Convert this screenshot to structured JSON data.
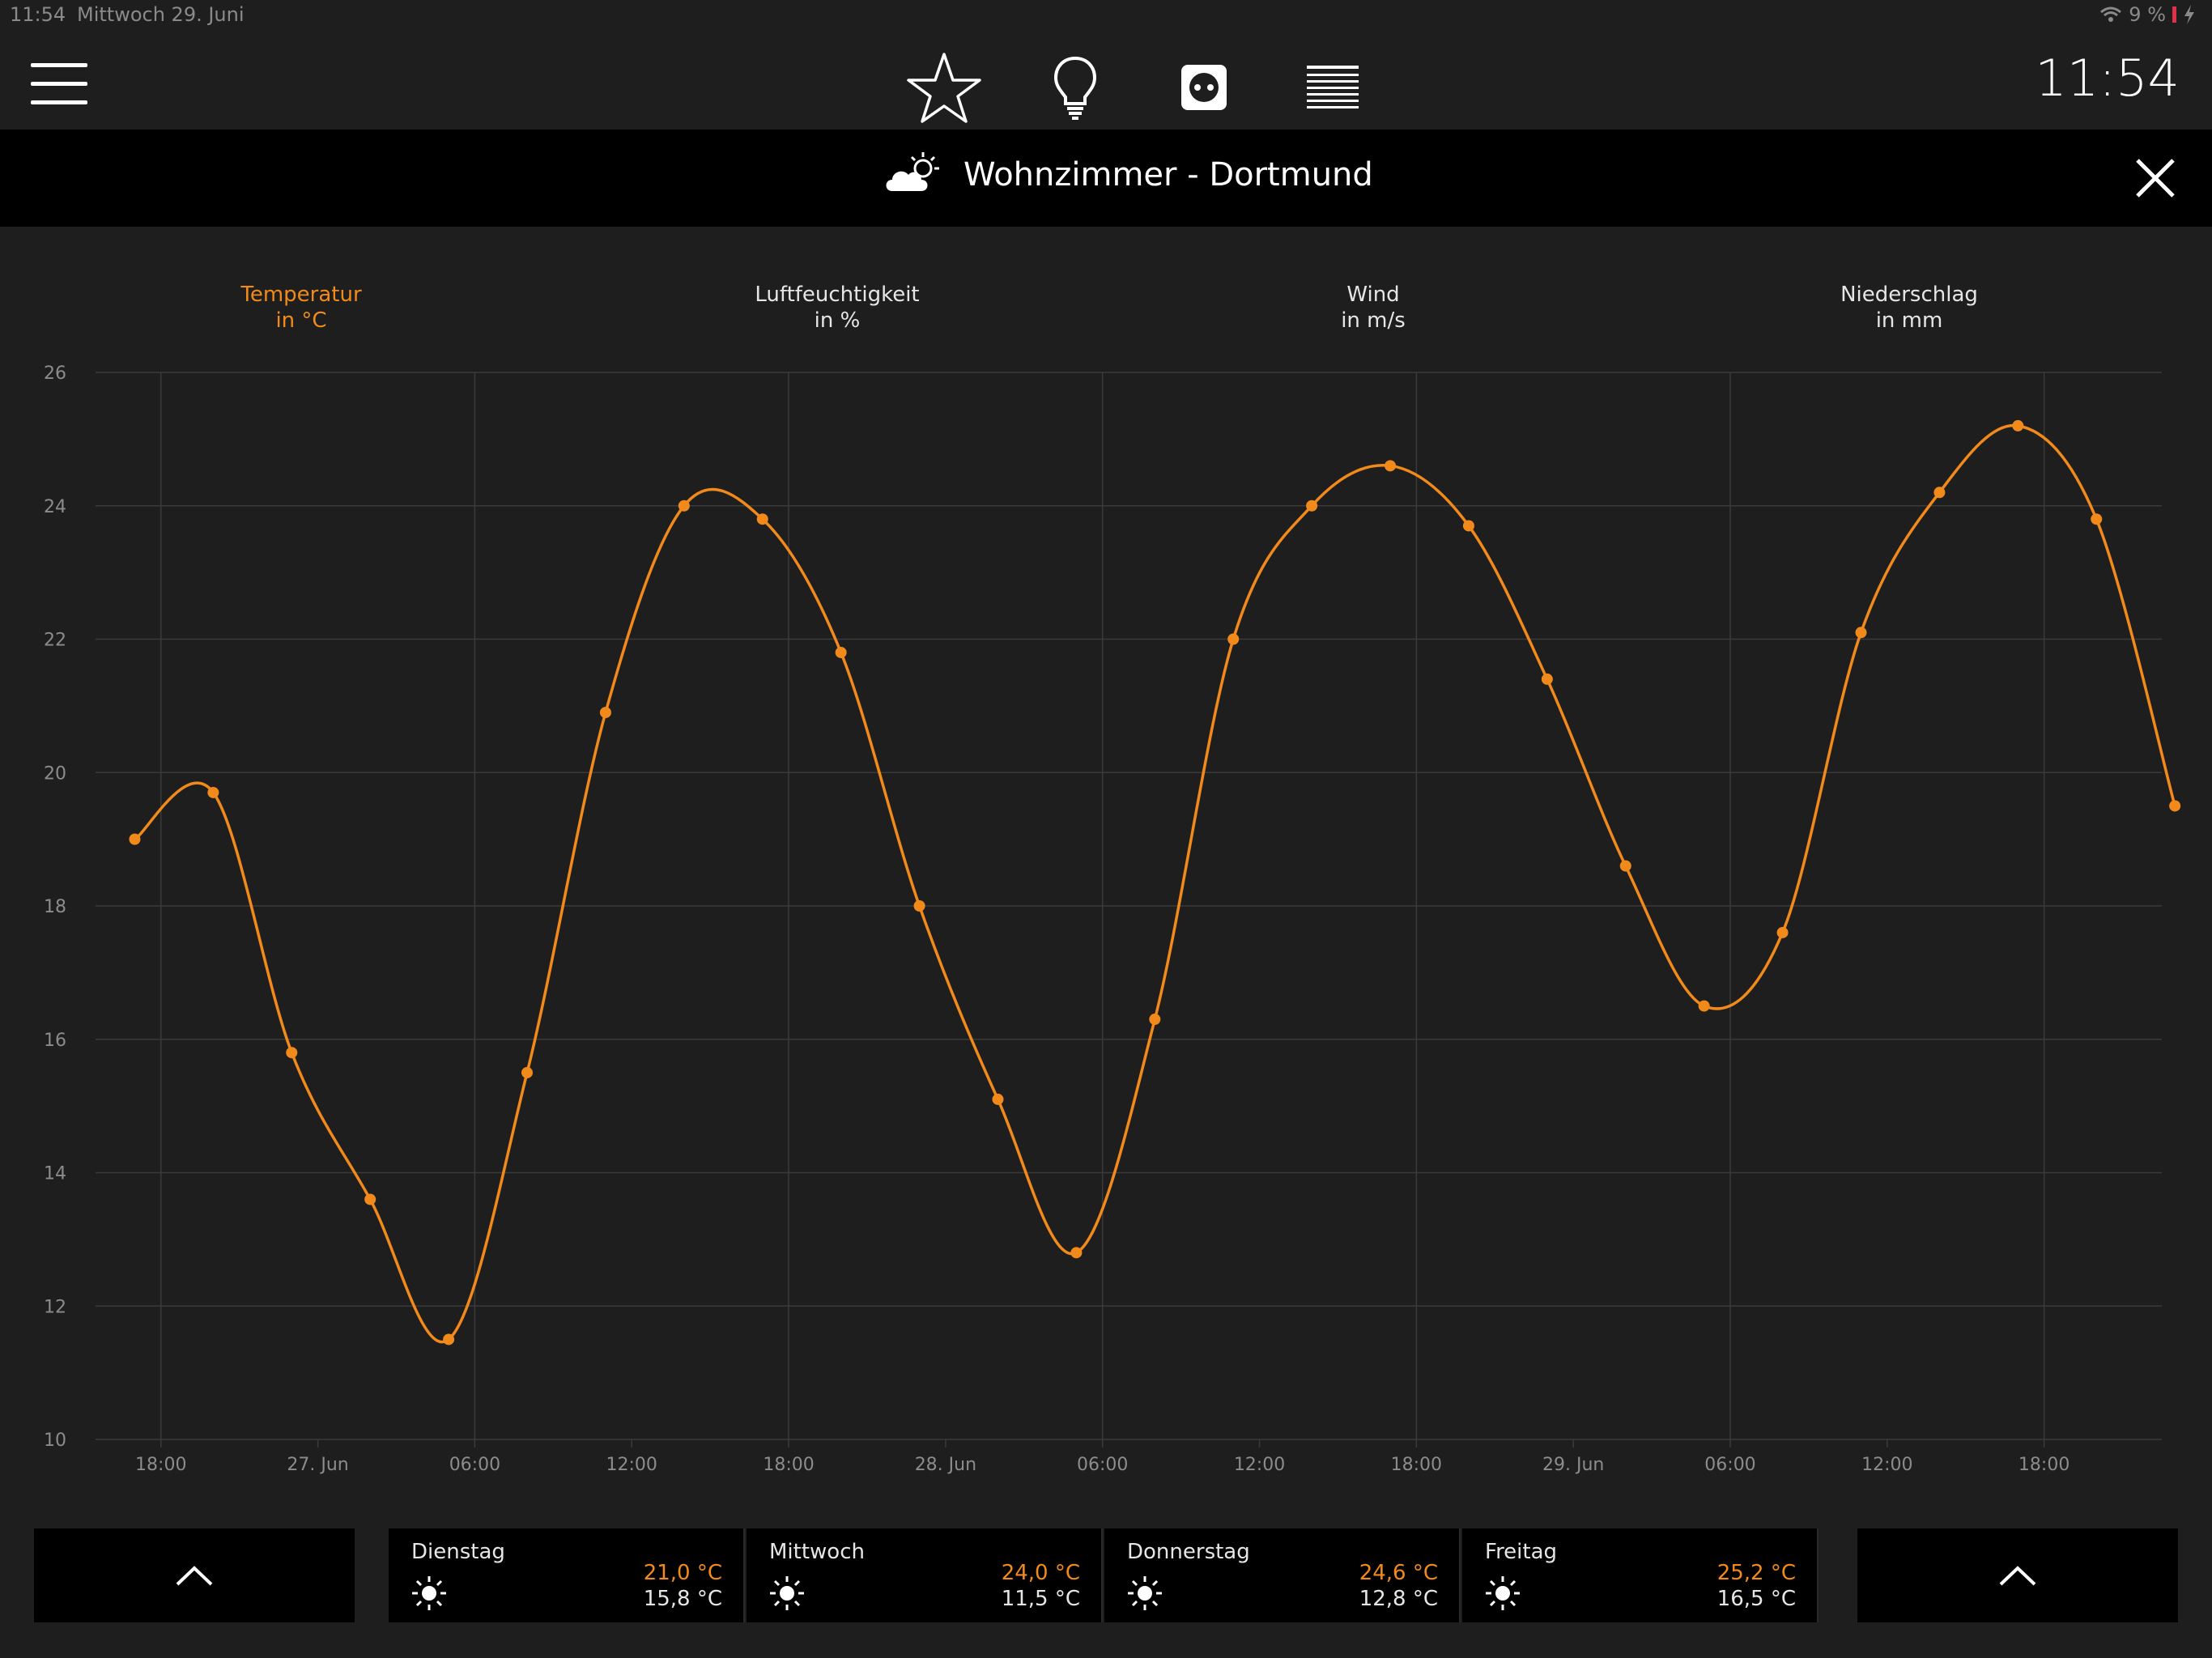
{
  "status_bar": {
    "time": "11:54",
    "date": "Mittwoch 29. Juni",
    "battery": "9 %"
  },
  "header": {
    "clock": "11:54",
    "icons": [
      "menu-icon",
      "star-icon",
      "lightbulb-icon",
      "socket-icon",
      "blinds-icon"
    ]
  },
  "titlebar": {
    "title": "Wohnzimmer - Dortmund",
    "icons": [
      "partly-cloudy-icon",
      "close-icon"
    ]
  },
  "tabs": [
    {
      "label": "Temperatur",
      "unit": "in °C",
      "active": true
    },
    {
      "label": "Luftfeuchtigkeit",
      "unit": "in %",
      "active": false
    },
    {
      "label": "Wind",
      "unit": "in m/s",
      "active": false
    },
    {
      "label": "Niederschlag",
      "unit": "in mm",
      "active": false
    }
  ],
  "colors": {
    "accent": "#f28a1b",
    "background": "#1e1e1e",
    "panel": "#000000",
    "grid": "#3a3a3a",
    "axis_text": "#8c8c8c"
  },
  "chart_data": {
    "type": "line",
    "title": "",
    "xlabel": "",
    "ylabel": "",
    "ylim": [
      10,
      26
    ],
    "yticks": [
      10,
      12,
      14,
      16,
      18,
      20,
      22,
      24,
      26
    ],
    "xlim_hours": [
      -2.5,
      76.5
    ],
    "xticks": [
      {
        "hour": 0,
        "label": "18:00"
      },
      {
        "hour": 6,
        "label": "27. Jun"
      },
      {
        "hour": 12,
        "label": "06:00"
      },
      {
        "hour": 18,
        "label": "12:00"
      },
      {
        "hour": 24,
        "label": "18:00"
      },
      {
        "hour": 30,
        "label": "28. Jun"
      },
      {
        "hour": 36,
        "label": "06:00"
      },
      {
        "hour": 42,
        "label": "12:00"
      },
      {
        "hour": 48,
        "label": "18:00"
      },
      {
        "hour": 54,
        "label": "29. Jun"
      },
      {
        "hour": 60,
        "label": "06:00"
      },
      {
        "hour": 66,
        "label": "12:00"
      },
      {
        "hour": 72,
        "label": "18:00"
      }
    ],
    "grid": true,
    "series": [
      {
        "x_hours": [
          -1,
          2,
          5,
          8,
          11,
          14,
          17,
          20,
          23,
          26,
          29,
          32,
          35,
          38,
          41,
          44,
          47,
          50,
          53,
          56,
          59,
          62,
          65,
          68,
          71,
          74,
          77
        ],
        "values": [
          19.0,
          19.7,
          15.8,
          13.6,
          11.5,
          15.5,
          20.9,
          24.0,
          23.8,
          21.8,
          18.0,
          15.1,
          12.8,
          16.3,
          22.0,
          24.0,
          24.6,
          23.7,
          21.4,
          18.6,
          16.5,
          17.6,
          22.1,
          24.2,
          25.2,
          23.8,
          19.5
        ]
      }
    ]
  },
  "forecast": [
    {
      "day": "Dienstag",
      "max": "21,0 °C",
      "min": "15,8 °C",
      "icon": "sun-icon"
    },
    {
      "day": "Mittwoch",
      "max": "24,0 °C",
      "min": "11,5 °C",
      "icon": "sun-icon"
    },
    {
      "day": "Donnerstag",
      "max": "24,6 °C",
      "min": "12,8 °C",
      "icon": "sun-icon"
    },
    {
      "day": "Freitag",
      "max": "25,2 °C",
      "min": "16,5 °C",
      "icon": "sun-icon"
    }
  ]
}
